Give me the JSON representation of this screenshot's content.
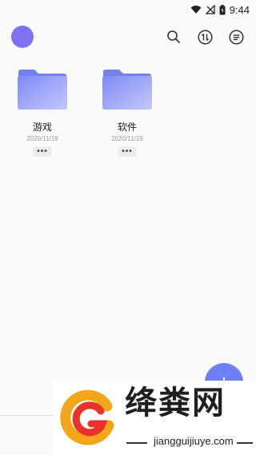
{
  "status_bar": {
    "time": "9:44",
    "icons": [
      "wifi-icon",
      "no-signal-icon",
      "battery-icon"
    ]
  },
  "top_bar": {
    "icons": [
      "search-icon",
      "sort-icon",
      "menu-icon"
    ]
  },
  "folders": [
    {
      "name": "游戏",
      "date": "2020/11/19",
      "more": "•••"
    },
    {
      "name": "软件",
      "date": "2020/11/19",
      "more": "•••"
    }
  ],
  "fab": {
    "label": "+"
  },
  "watermark": {
    "title": "绛粪网",
    "url": "jiangguijiuye.com"
  },
  "colors": {
    "accent": "#6e7ff5",
    "avatar": "#7b73f2",
    "folder": "#8b96f8"
  }
}
